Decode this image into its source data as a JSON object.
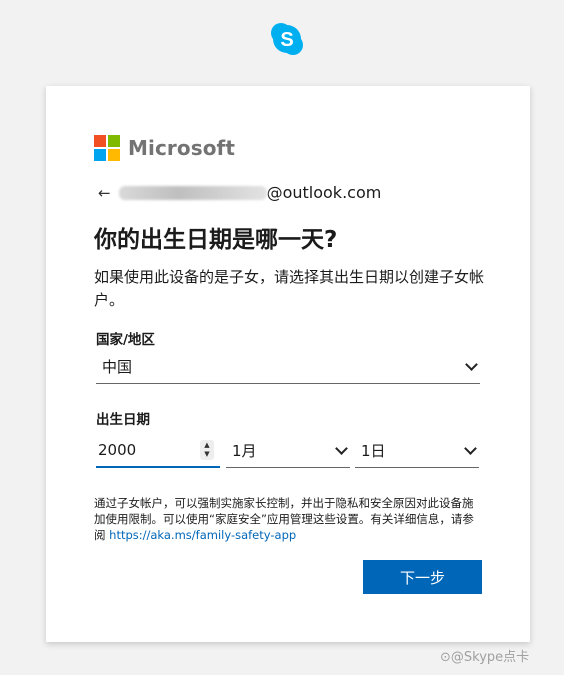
{
  "app": {
    "logo_icon": "skype-logo-icon",
    "logo_letter": "S",
    "brand_color": "#00aff0"
  },
  "card": {
    "brand_name": "Microsoft",
    "brand_colors": [
      "#f25022",
      "#7fba00",
      "#00a4ef",
      "#ffb900"
    ],
    "identity_suffix": "@outlook.com",
    "back_icon": "left-arrow-icon",
    "title": "你的出生日期是哪一天?",
    "description": "如果使用此设备的是子女，请选择其出生日期以创建子女帐户。",
    "country_label": "国家/地区",
    "country_value": "中国",
    "birthdate_label": "出生日期",
    "year_value": "2000",
    "month_value": "1月",
    "day_value": "1日",
    "notice_text": "通过子女帐户，可以强制实施家长控制，并出于隐私和安全原因对此设备施加使用限制。可以使用“家庭安全”应用管理这些设置。有关详细信息，请参阅",
    "notice_link": "https://aka.ms/family-safety-app",
    "next_label": "下一步",
    "accent_color": "#0067b8"
  },
  "watermark": "⊙@Skype点卡"
}
